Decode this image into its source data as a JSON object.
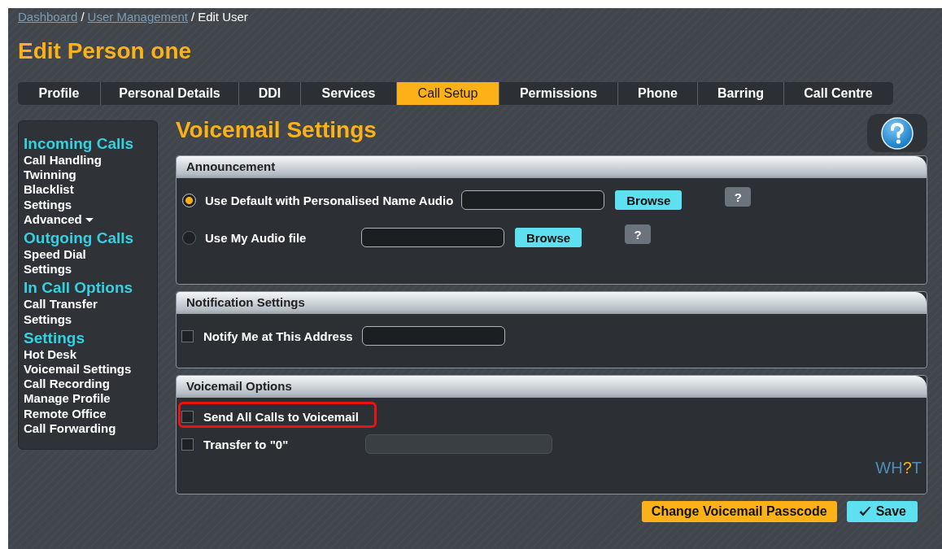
{
  "breadcrumb": [
    {
      "kind": "link",
      "label": "Dashboard"
    },
    {
      "kind": "separator",
      "label": "/"
    },
    {
      "kind": "link",
      "label": "User Management"
    },
    {
      "kind": "separator",
      "label": "/"
    },
    {
      "kind": "current",
      "label": "Edit User"
    }
  ],
  "title": "Edit Person one",
  "tabs": [
    {
      "label": "Profile",
      "selected": false
    },
    {
      "label": "Personal Details",
      "selected": false
    },
    {
      "label": "DDI",
      "selected": false
    },
    {
      "label": "Services",
      "selected": false
    },
    {
      "label": "Call Setup",
      "selected": true
    },
    {
      "label": "Permissions",
      "selected": false
    },
    {
      "label": "Phone",
      "selected": false
    },
    {
      "label": "Barring",
      "selected": false
    },
    {
      "label": "Call Centre",
      "selected": false
    }
  ],
  "sidebar": [
    {
      "heading": "Incoming Calls",
      "items": [
        {
          "label": "Call Handling"
        },
        {
          "label": "Twinning"
        },
        {
          "label": "Blacklist"
        },
        {
          "label": "Settings"
        },
        {
          "label": "Advanced",
          "dropdown": true
        }
      ]
    },
    {
      "heading": "Outgoing Calls",
      "items": [
        {
          "label": "Speed Dial"
        },
        {
          "label": "Settings"
        }
      ]
    },
    {
      "heading": "In Call Options",
      "items": [
        {
          "label": "Call Transfer"
        },
        {
          "label": "Settings"
        }
      ]
    },
    {
      "heading": "Settings",
      "items": [
        {
          "label": "Hot Desk"
        },
        {
          "label": "Voicemail Settings"
        },
        {
          "label": "Call Recording"
        },
        {
          "label": "Manage Profile"
        },
        {
          "label": "Remote Office"
        },
        {
          "label": "Call Forwarding"
        }
      ]
    }
  ],
  "heading": "Voicemail Settings",
  "sections": [
    {
      "title": "Announcement",
      "rows": [
        {
          "kind": "radio",
          "label": "Use Default with Personalised Name Audio",
          "selected": true,
          "field": {
            "disabled": false
          },
          "browse": "Browse",
          "help": "?"
        },
        {
          "kind": "radio",
          "label": "Use My Audio file",
          "selected": false,
          "field": {
            "disabled": false
          },
          "browse": "Browse",
          "help": "?"
        }
      ]
    },
    {
      "title": "Notification Settings",
      "rows": [
        {
          "kind": "checkbox",
          "label": "Notify Me at This Address",
          "checked": false,
          "highlighted": false,
          "field": {
            "disabled": false
          }
        }
      ]
    },
    {
      "title": "Voicemail Options",
      "rows": [
        {
          "kind": "checkbox",
          "label": "Send All Calls to Voicemail",
          "checked": false,
          "highlighted": true
        },
        {
          "kind": "checkbox",
          "label": "Transfer to \"0\"",
          "checked": false,
          "highlighted": false,
          "field": {
            "disabled": true
          }
        }
      ],
      "logo": [
        "WH",
        "?",
        "T"
      ]
    }
  ],
  "buttons": [
    {
      "kind": "passcode",
      "label": "Change Voicemail Passcode"
    },
    {
      "kind": "save",
      "label": "Save"
    }
  ]
}
